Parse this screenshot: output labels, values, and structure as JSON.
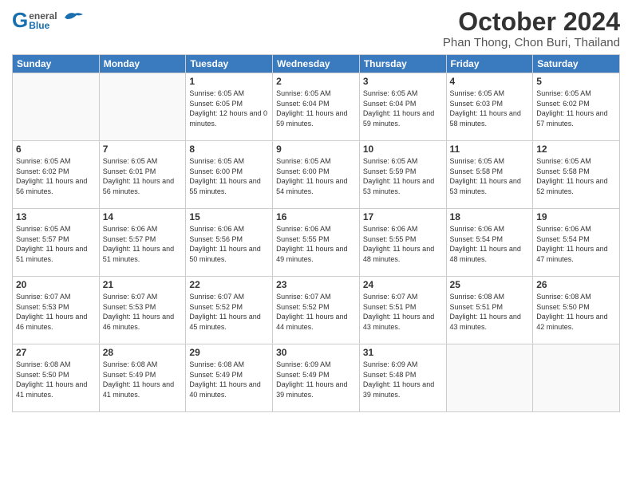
{
  "header": {
    "logo_general": "General",
    "logo_blue": "Blue",
    "month": "October 2024",
    "location": "Phan Thong, Chon Buri, Thailand"
  },
  "days_of_week": [
    "Sunday",
    "Monday",
    "Tuesday",
    "Wednesday",
    "Thursday",
    "Friday",
    "Saturday"
  ],
  "weeks": [
    [
      {
        "day": "",
        "empty": true
      },
      {
        "day": "",
        "empty": true
      },
      {
        "day": "1",
        "sunrise": "Sunrise: 6:05 AM",
        "sunset": "Sunset: 6:05 PM",
        "daylight": "Daylight: 12 hours and 0 minutes."
      },
      {
        "day": "2",
        "sunrise": "Sunrise: 6:05 AM",
        "sunset": "Sunset: 6:04 PM",
        "daylight": "Daylight: 11 hours and 59 minutes."
      },
      {
        "day": "3",
        "sunrise": "Sunrise: 6:05 AM",
        "sunset": "Sunset: 6:04 PM",
        "daylight": "Daylight: 11 hours and 59 minutes."
      },
      {
        "day": "4",
        "sunrise": "Sunrise: 6:05 AM",
        "sunset": "Sunset: 6:03 PM",
        "daylight": "Daylight: 11 hours and 58 minutes."
      },
      {
        "day": "5",
        "sunrise": "Sunrise: 6:05 AM",
        "sunset": "Sunset: 6:02 PM",
        "daylight": "Daylight: 11 hours and 57 minutes."
      }
    ],
    [
      {
        "day": "6",
        "sunrise": "Sunrise: 6:05 AM",
        "sunset": "Sunset: 6:02 PM",
        "daylight": "Daylight: 11 hours and 56 minutes."
      },
      {
        "day": "7",
        "sunrise": "Sunrise: 6:05 AM",
        "sunset": "Sunset: 6:01 PM",
        "daylight": "Daylight: 11 hours and 56 minutes."
      },
      {
        "day": "8",
        "sunrise": "Sunrise: 6:05 AM",
        "sunset": "Sunset: 6:00 PM",
        "daylight": "Daylight: 11 hours and 55 minutes."
      },
      {
        "day": "9",
        "sunrise": "Sunrise: 6:05 AM",
        "sunset": "Sunset: 6:00 PM",
        "daylight": "Daylight: 11 hours and 54 minutes."
      },
      {
        "day": "10",
        "sunrise": "Sunrise: 6:05 AM",
        "sunset": "Sunset: 5:59 PM",
        "daylight": "Daylight: 11 hours and 53 minutes."
      },
      {
        "day": "11",
        "sunrise": "Sunrise: 6:05 AM",
        "sunset": "Sunset: 5:58 PM",
        "daylight": "Daylight: 11 hours and 53 minutes."
      },
      {
        "day": "12",
        "sunrise": "Sunrise: 6:05 AM",
        "sunset": "Sunset: 5:58 PM",
        "daylight": "Daylight: 11 hours and 52 minutes."
      }
    ],
    [
      {
        "day": "13",
        "sunrise": "Sunrise: 6:05 AM",
        "sunset": "Sunset: 5:57 PM",
        "daylight": "Daylight: 11 hours and 51 minutes."
      },
      {
        "day": "14",
        "sunrise": "Sunrise: 6:06 AM",
        "sunset": "Sunset: 5:57 PM",
        "daylight": "Daylight: 11 hours and 51 minutes."
      },
      {
        "day": "15",
        "sunrise": "Sunrise: 6:06 AM",
        "sunset": "Sunset: 5:56 PM",
        "daylight": "Daylight: 11 hours and 50 minutes."
      },
      {
        "day": "16",
        "sunrise": "Sunrise: 6:06 AM",
        "sunset": "Sunset: 5:55 PM",
        "daylight": "Daylight: 11 hours and 49 minutes."
      },
      {
        "day": "17",
        "sunrise": "Sunrise: 6:06 AM",
        "sunset": "Sunset: 5:55 PM",
        "daylight": "Daylight: 11 hours and 48 minutes."
      },
      {
        "day": "18",
        "sunrise": "Sunrise: 6:06 AM",
        "sunset": "Sunset: 5:54 PM",
        "daylight": "Daylight: 11 hours and 48 minutes."
      },
      {
        "day": "19",
        "sunrise": "Sunrise: 6:06 AM",
        "sunset": "Sunset: 5:54 PM",
        "daylight": "Daylight: 11 hours and 47 minutes."
      }
    ],
    [
      {
        "day": "20",
        "sunrise": "Sunrise: 6:07 AM",
        "sunset": "Sunset: 5:53 PM",
        "daylight": "Daylight: 11 hours and 46 minutes."
      },
      {
        "day": "21",
        "sunrise": "Sunrise: 6:07 AM",
        "sunset": "Sunset: 5:53 PM",
        "daylight": "Daylight: 11 hours and 46 minutes."
      },
      {
        "day": "22",
        "sunrise": "Sunrise: 6:07 AM",
        "sunset": "Sunset: 5:52 PM",
        "daylight": "Daylight: 11 hours and 45 minutes."
      },
      {
        "day": "23",
        "sunrise": "Sunrise: 6:07 AM",
        "sunset": "Sunset: 5:52 PM",
        "daylight": "Daylight: 11 hours and 44 minutes."
      },
      {
        "day": "24",
        "sunrise": "Sunrise: 6:07 AM",
        "sunset": "Sunset: 5:51 PM",
        "daylight": "Daylight: 11 hours and 43 minutes."
      },
      {
        "day": "25",
        "sunrise": "Sunrise: 6:08 AM",
        "sunset": "Sunset: 5:51 PM",
        "daylight": "Daylight: 11 hours and 43 minutes."
      },
      {
        "day": "26",
        "sunrise": "Sunrise: 6:08 AM",
        "sunset": "Sunset: 5:50 PM",
        "daylight": "Daylight: 11 hours and 42 minutes."
      }
    ],
    [
      {
        "day": "27",
        "sunrise": "Sunrise: 6:08 AM",
        "sunset": "Sunset: 5:50 PM",
        "daylight": "Daylight: 11 hours and 41 minutes."
      },
      {
        "day": "28",
        "sunrise": "Sunrise: 6:08 AM",
        "sunset": "Sunset: 5:49 PM",
        "daylight": "Daylight: 11 hours and 41 minutes."
      },
      {
        "day": "29",
        "sunrise": "Sunrise: 6:08 AM",
        "sunset": "Sunset: 5:49 PM",
        "daylight": "Daylight: 11 hours and 40 minutes."
      },
      {
        "day": "30",
        "sunrise": "Sunrise: 6:09 AM",
        "sunset": "Sunset: 5:49 PM",
        "daylight": "Daylight: 11 hours and 39 minutes."
      },
      {
        "day": "31",
        "sunrise": "Sunrise: 6:09 AM",
        "sunset": "Sunset: 5:48 PM",
        "daylight": "Daylight: 11 hours and 39 minutes."
      },
      {
        "day": "",
        "empty": true
      },
      {
        "day": "",
        "empty": true
      }
    ]
  ]
}
